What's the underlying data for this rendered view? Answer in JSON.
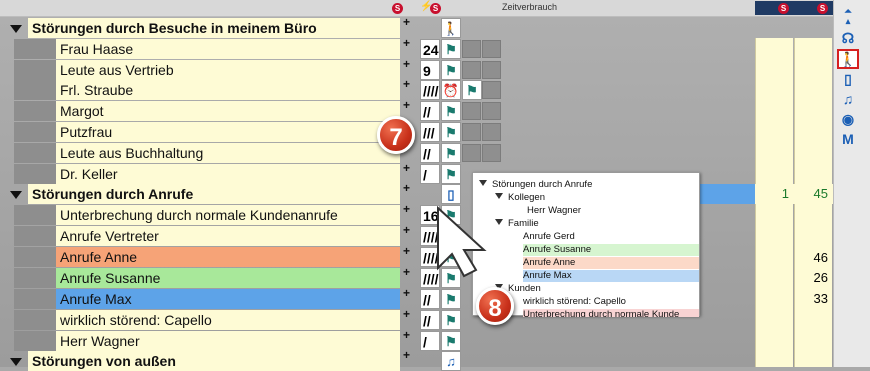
{
  "header": {
    "zeitverbrauch_label": "Zeitverbrauch",
    "s_badge": "S"
  },
  "groups": [
    {
      "label": "Störungen durch Besuche in meinem Büro",
      "icon": "walking-person-icon"
    },
    {
      "label": "Störungen durch Anrufe",
      "icon": "phone-icon"
    },
    {
      "label": "Störungen von außen",
      "icon": "music-note-icon"
    }
  ],
  "rows": [
    {
      "label": "Frau Haase",
      "count": "24",
      "bg": "#fefbd5"
    },
    {
      "label": "Leute aus Vertrieb",
      "count": "9",
      "bg": "#fefbd5"
    },
    {
      "label": "Frl. Straube",
      "count": "////",
      "bg": "#fefbd5"
    },
    {
      "label": "Margot",
      "count": "//",
      "bg": "#fefbd5"
    },
    {
      "label": "Putzfrau",
      "count": "///",
      "bg": "#fefbd5"
    },
    {
      "label": "Leute aus Buchhaltung",
      "count": "//",
      "bg": "#fefbd5"
    },
    {
      "label": "Dr. Keller",
      "count": "/",
      "bg": "#fefbd5"
    },
    {
      "label": "Unterbrechung durch normale Kundenanrufe",
      "count": "16",
      "bg": "#fefbd5"
    },
    {
      "label": "Anrufe Vertreter",
      "count": "////",
      "bg": "#fefbd5"
    },
    {
      "label": "Anrufe Anne",
      "count": "////",
      "bg": "#f6a377"
    },
    {
      "label": "Anrufe Susanne",
      "count": "////",
      "bg": "#a8e89a"
    },
    {
      "label": "Anrufe Max",
      "count": "//",
      "bg": "#5da3e8"
    },
    {
      "label": "wirklich störend: Capello",
      "count": "//",
      "bg": "#fefbd5"
    },
    {
      "label": "Herr Wagner",
      "count": "/",
      "bg": "#fefbd5"
    }
  ],
  "right_values": {
    "blue_row_col1": "1",
    "blue_row_col2": "45",
    "anne": "46",
    "susanne": "26",
    "max": "33"
  },
  "popup": {
    "items": [
      {
        "text": "Störungen durch Anrufe",
        "bg": "#ffffff"
      },
      {
        "text": "Kollegen",
        "bg": "#ffffff"
      },
      {
        "text": "Herr Wagner",
        "bg": "#ffffff"
      },
      {
        "text": "Familie",
        "bg": "#ffffff"
      },
      {
        "text": "Anrufe Gerd",
        "bg": "#ffffff"
      },
      {
        "text": "Anrufe Susanne",
        "bg": "#d6f5d0"
      },
      {
        "text": "Anrufe Anne",
        "bg": "#fcd9c8"
      },
      {
        "text": "Anrufe Max",
        "bg": "#b9d7f5"
      },
      {
        "text": "Kunden",
        "bg": "#ffffff"
      },
      {
        "text": "wirklich störend: Capello",
        "bg": "#ffffff"
      },
      {
        "text": "Unterbrechung  durch  normale Kunde",
        "bg": "#f8d3d3"
      }
    ]
  },
  "sidebar": {
    "m_label": "M"
  },
  "callouts": {
    "seven": "7",
    "eight": "8"
  }
}
